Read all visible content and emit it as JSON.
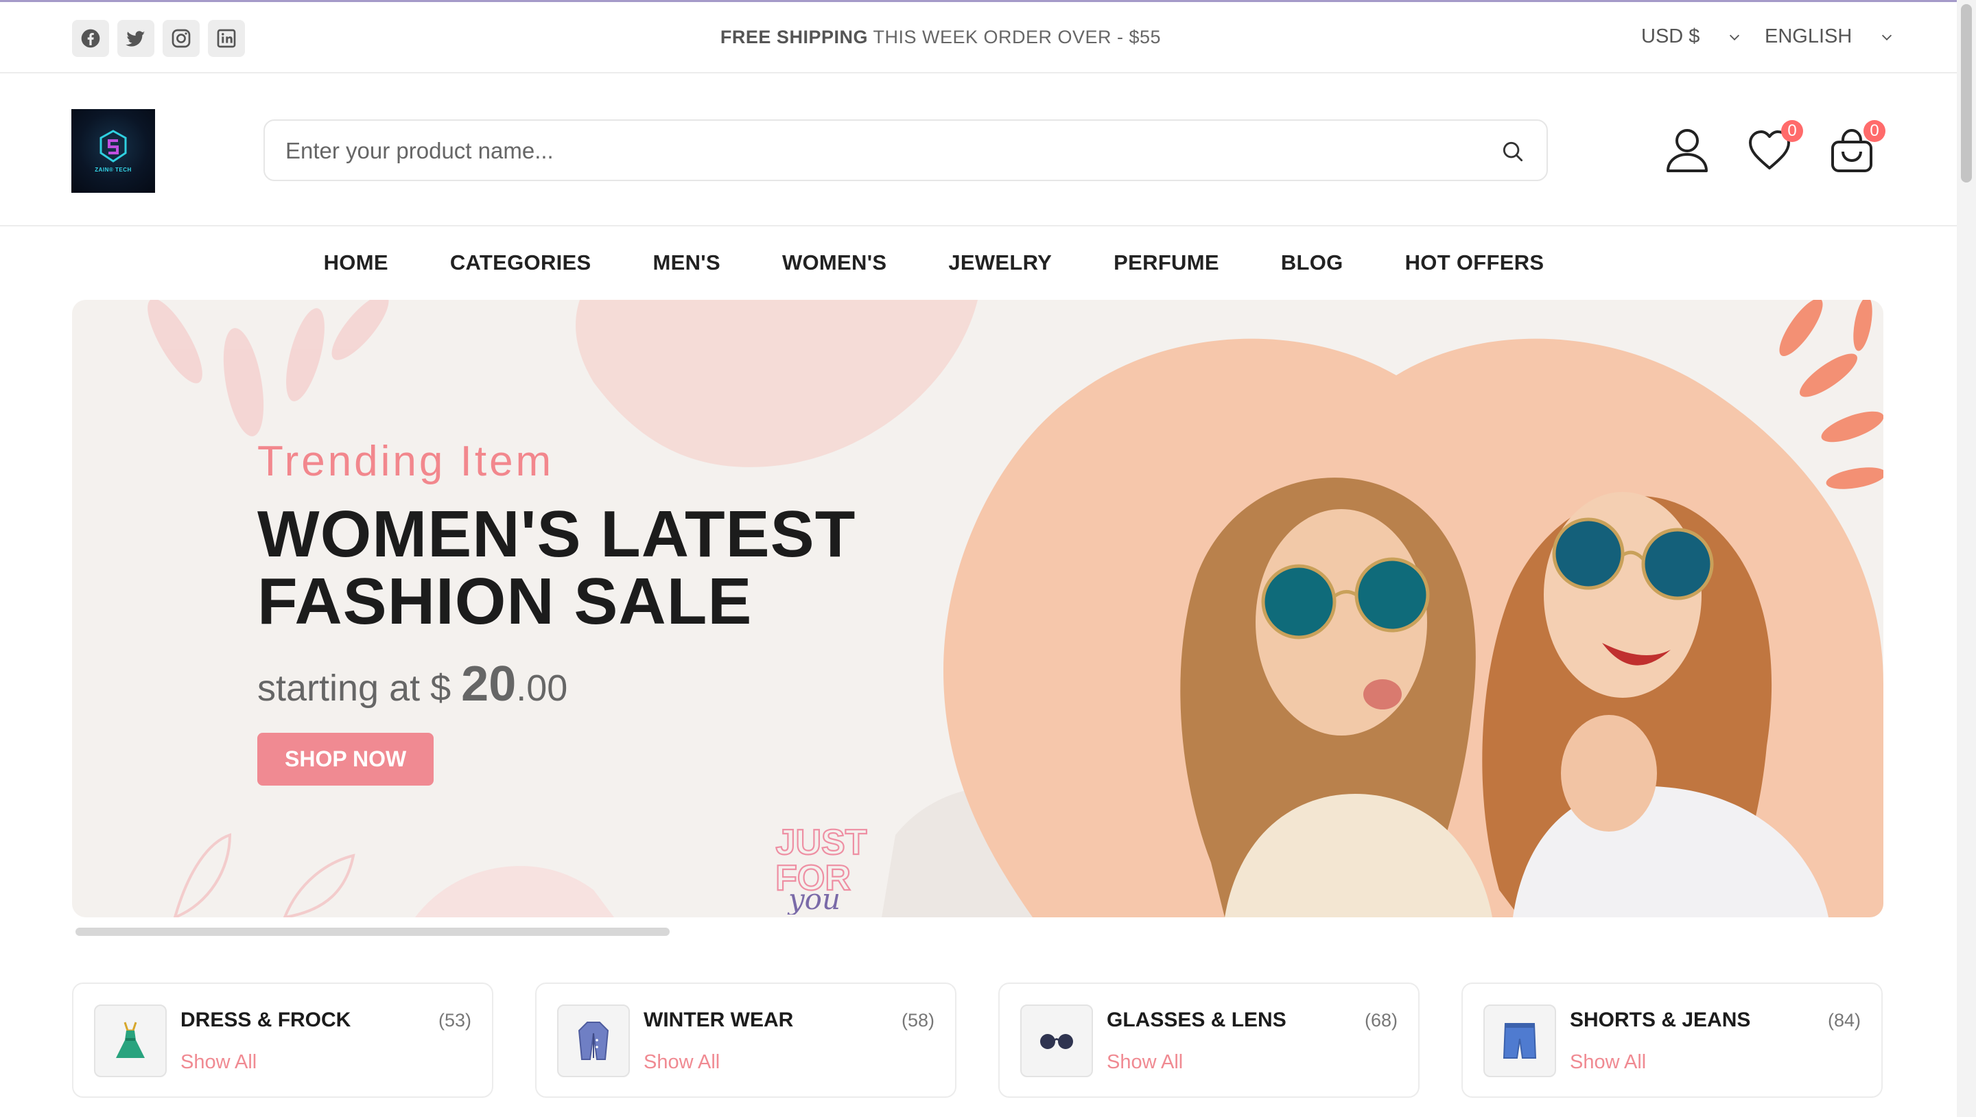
{
  "topbar": {
    "social_icons": [
      "facebook-icon",
      "twitter-icon",
      "instagram-icon",
      "linkedin-icon"
    ],
    "promo_bold": "FREE SHIPPING",
    "promo_rest": " THIS WEEK ORDER OVER - $55",
    "currency": "USD $",
    "language": "ENGLISH"
  },
  "header": {
    "logo_text": "ZAIN® TECH",
    "search_placeholder": "Enter your product name...",
    "wishlist_count": "0",
    "cart_count": "0"
  },
  "nav": {
    "items": [
      "HOME",
      "CATEGORIES",
      "MEN'S",
      "WOMEN'S",
      "JEWELRY",
      "PERFUME",
      "BLOG",
      "HOT OFFERS"
    ]
  },
  "hero": {
    "kicker": "Trending Item",
    "title_line1": "WOMEN'S LATEST",
    "title_line2": "FASHION SALE",
    "price_prefix": "starting at $ ",
    "price_whole": "20",
    "price_cents": ".00",
    "cta": "SHOP NOW",
    "badge_line1": "JUST",
    "badge_line2": "FOR",
    "badge_line3": "you"
  },
  "categories": [
    {
      "name": "DRESS & FROCK",
      "count": "(53)",
      "link": "Show All",
      "icon": "dress-icon"
    },
    {
      "name": "WINTER WEAR",
      "count": "(58)",
      "link": "Show All",
      "icon": "coat-icon"
    },
    {
      "name": "GLASSES & LENS",
      "count": "(68)",
      "link": "Show All",
      "icon": "glasses-icon"
    },
    {
      "name": "SHORTS & JEANS",
      "count": "(84)",
      "link": "Show All",
      "icon": "shorts-icon"
    }
  ],
  "colors": {
    "accent": "#f08a92",
    "badge": "#ff6b6b",
    "hero_bg": "#f4f1ee",
    "heart_shape": "#f6c7ab"
  }
}
